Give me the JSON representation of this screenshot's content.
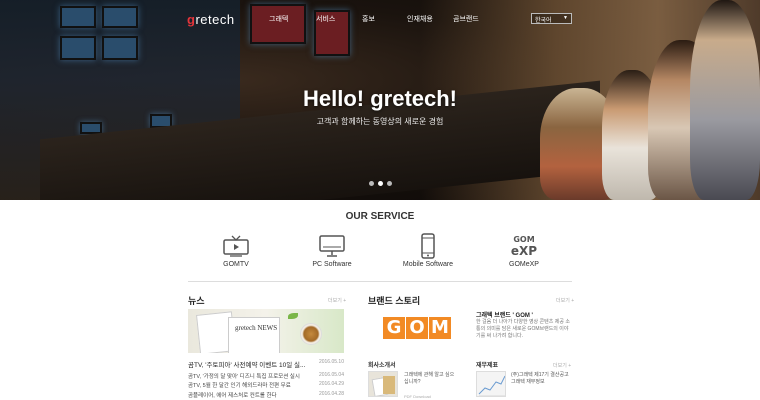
{
  "logo": {
    "prefix": "g",
    "rest": "retech"
  },
  "nav": {
    "items": [
      {
        "label": "그래텍"
      },
      {
        "label": "서비스"
      },
      {
        "label": "홍보"
      },
      {
        "label": "인재채용"
      },
      {
        "label": "곰브랜드"
      }
    ],
    "language": "한국어"
  },
  "hero": {
    "title": "Hello! gretech!",
    "subtitle": "고객과 함께하는 동영상의 새로운 경험",
    "slides": 3,
    "active_slide": 1
  },
  "services": {
    "title": "OUR SERVICE",
    "items": [
      {
        "label": "GOMTV",
        "icon": "tv-icon"
      },
      {
        "label": "PC Software",
        "icon": "monitor-icon"
      },
      {
        "label": "Mobile Software",
        "icon": "smartphone-icon"
      },
      {
        "label": "GOMeXP",
        "icon": "gomexp-icon"
      }
    ],
    "gomexp_glyph": "GOM",
    "gomexp_glyph2": "eXP"
  },
  "news": {
    "title": "뉴스",
    "more": "더보기 +",
    "image_text": "gretech NEWS",
    "items": [
      {
        "text": "곰TV, '주토피아' 사전예약 이벤트 10일 실...",
        "date": "2016.05.10"
      },
      {
        "text": "곰TV, '가정의 달 맞아' 디즈니 특집 프로모션 실시",
        "date": "2016.05.04"
      },
      {
        "text": "곰TV, 5월 한 달간 인기 해외드라마 전편 무료",
        "date": "2016.04.29"
      },
      {
        "text": "곰플레이어, 에어 제스처로 컨트롤 한다",
        "date": "2016.04.28"
      }
    ]
  },
  "brand": {
    "title": "브랜드 스토리",
    "more": "더보기 +",
    "logo_letters": [
      "G",
      "O",
      "M"
    ],
    "headline": "그래텍 브랜드 ' GOM '",
    "text": "한 걸음 더 나아가 다양한 영상 콘텐츠 제공 소통의 의미를 담은 새로운 GOM브랜드의 이야기를 써 나가려 합니다."
  },
  "company": {
    "title": "회사소개서",
    "text": "그래텍에 관해 알고 싶으십니까?",
    "pdf": "PDF Download"
  },
  "finance": {
    "title": "재무제표",
    "more": "더보기 +",
    "text": "(주)그래텍 제17기 결산공고",
    "text2": "그래텍 재무정보"
  }
}
